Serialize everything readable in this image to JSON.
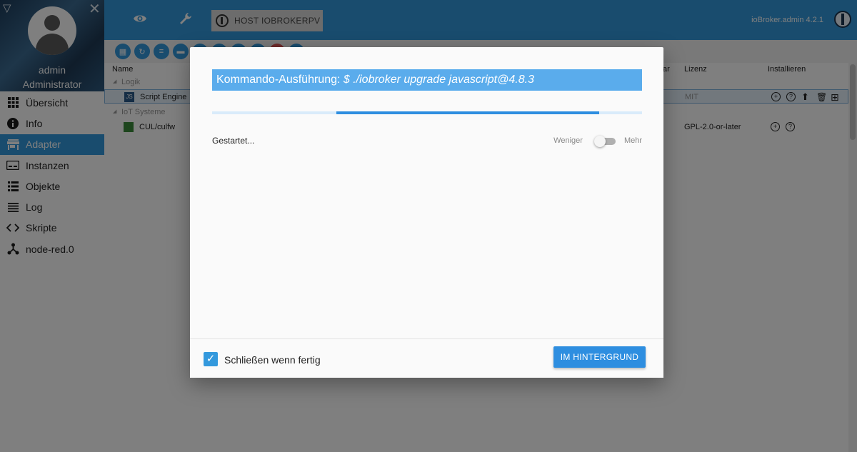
{
  "sidebar": {
    "user_name": "admin",
    "user_role": "Administrator",
    "items": [
      {
        "label": "Übersicht",
        "icon": "grid-icon"
      },
      {
        "label": "Info",
        "icon": "info-icon"
      },
      {
        "label": "Adapter",
        "icon": "store-icon",
        "active": true
      },
      {
        "label": "Instanzen",
        "icon": "instances-icon"
      },
      {
        "label": "Objekte",
        "icon": "list-icon"
      },
      {
        "label": "Log",
        "icon": "log-icon"
      },
      {
        "label": "Skripte",
        "icon": "code-icon"
      },
      {
        "label": "node-red.0",
        "icon": "node-red-icon"
      }
    ]
  },
  "topbar": {
    "host_label": "HOST IOBROKERPV",
    "version": "ioBroker.admin 4.2.1"
  },
  "table": {
    "headers": {
      "name": "Name",
      "partial": "ar",
      "license": "Lizenz",
      "install": "Installieren"
    },
    "groups": [
      {
        "label": "Logik",
        "rows": [
          {
            "name": "Script Engine",
            "license": "MIT"
          }
        ]
      },
      {
        "label": "IoT Systeme",
        "rows": [
          {
            "name": "CUL/culfw",
            "license": "GPL-2.0-or-later"
          }
        ]
      }
    ]
  },
  "dialog": {
    "title_prefix": "Kommando-Ausführung:",
    "command": "$ ./iobroker upgrade javascript@4.8.3",
    "progress_percent": 61,
    "status": "Gestartet...",
    "toggle_less": "Weniger",
    "toggle_more": "Mehr",
    "toggle_on": false,
    "close_when_done_label": "Schließen wenn fertig",
    "close_when_done_checked": true,
    "background_button": "IM HINTERGRUND"
  },
  "colors": {
    "accent": "#3399dd",
    "title_bar": "#5aacec",
    "progress": "#2e8ee0"
  }
}
